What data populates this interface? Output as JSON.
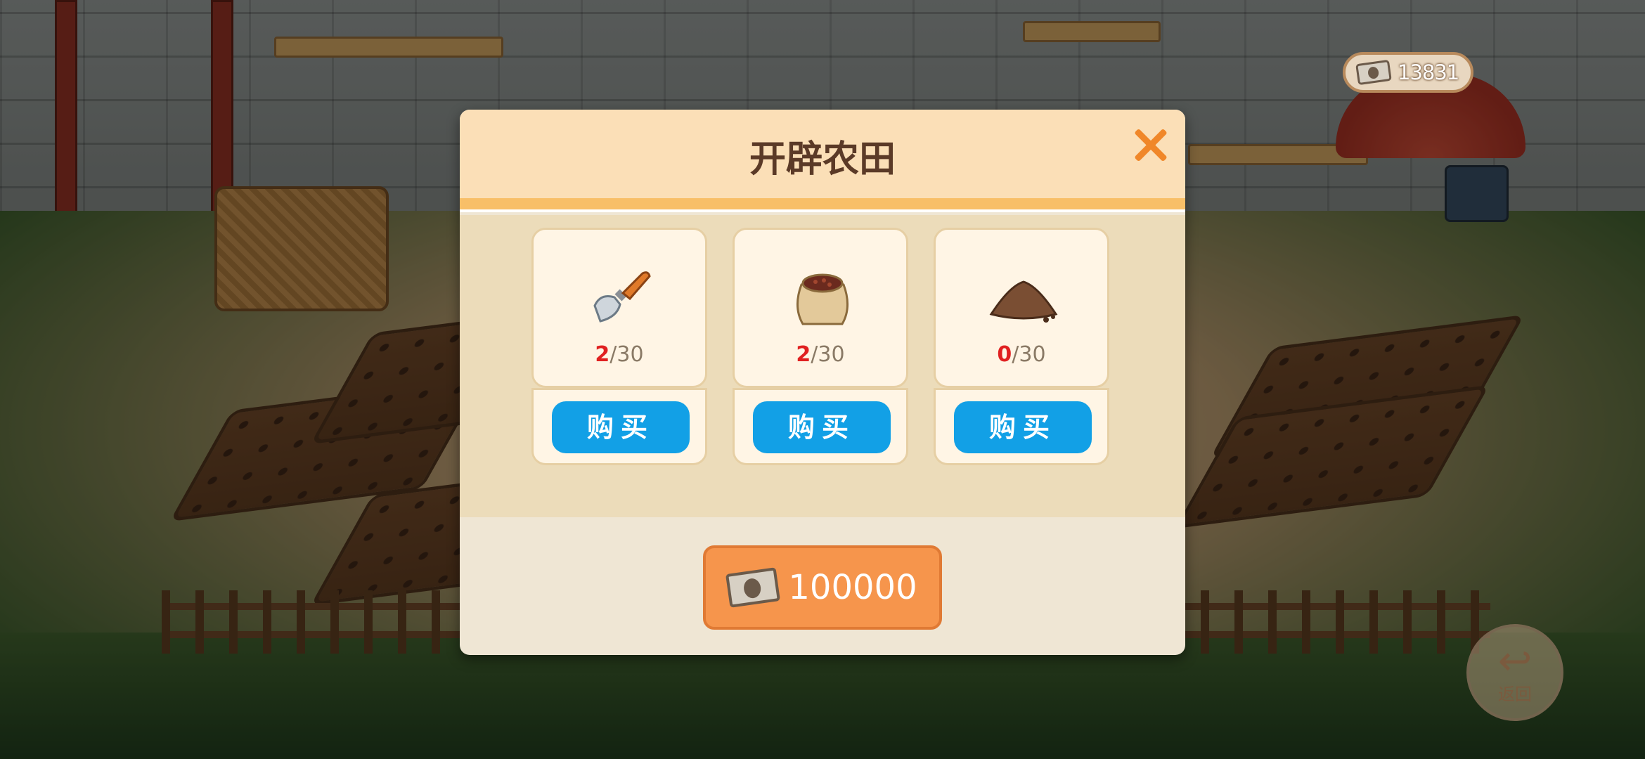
{
  "hud": {
    "currency_icon": "banknote-icon",
    "currency_value": "13831",
    "back_label": "返回"
  },
  "dialog": {
    "title": "开辟农田",
    "close_icon": "close-icon",
    "items": [
      {
        "icon": "trowel-icon",
        "have": "2",
        "need": "/30",
        "buy_label": "购买"
      },
      {
        "icon": "seed-sack-icon",
        "have": "2",
        "need": "/30",
        "buy_label": "购买"
      },
      {
        "icon": "soil-pile-icon",
        "have": "0",
        "need": "/30",
        "buy_label": "购买"
      }
    ],
    "cost": {
      "icon": "banknote-icon",
      "value": "100000"
    }
  },
  "colors": {
    "accent_orange": "#f6954c",
    "buy_blue": "#12a0e6",
    "count_red": "#e02020",
    "title_brown": "#5b3a27"
  }
}
